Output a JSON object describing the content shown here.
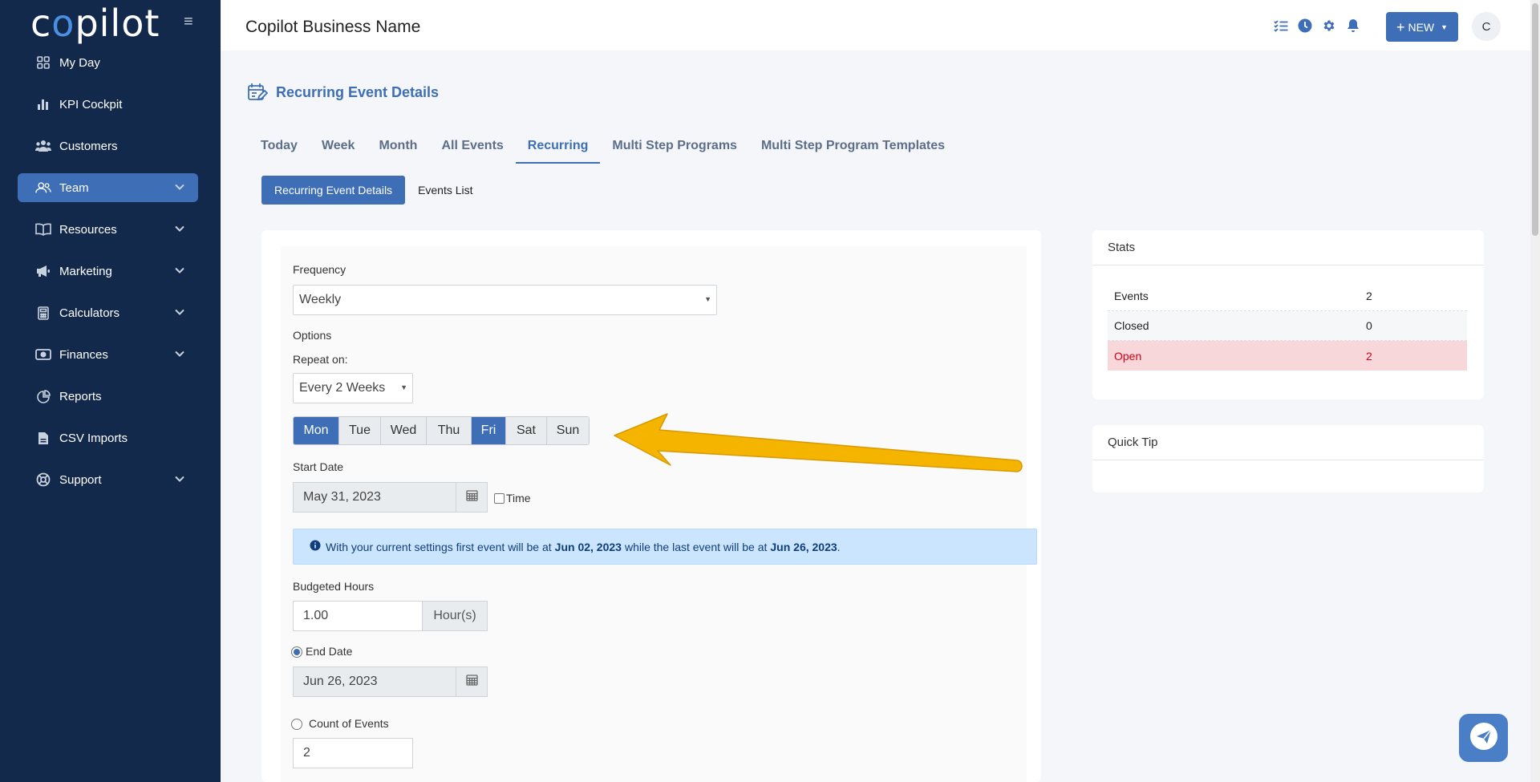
{
  "sidebar": {
    "logo": "copilot",
    "items": [
      {
        "label": "My Day",
        "icon": "grid-icon"
      },
      {
        "label": "KPI Cockpit",
        "icon": "bar-chart-icon"
      },
      {
        "label": "Customers",
        "icon": "users-icon"
      },
      {
        "label": "Team",
        "icon": "team-icon",
        "active": true,
        "expandable": true
      },
      {
        "label": "Resources",
        "icon": "book-icon",
        "expandable": true
      },
      {
        "label": "Marketing",
        "icon": "megaphone-icon",
        "expandable": true
      },
      {
        "label": "Calculators",
        "icon": "calculator-icon",
        "expandable": true
      },
      {
        "label": "Finances",
        "icon": "money-icon",
        "expandable": true
      },
      {
        "label": "Reports",
        "icon": "pie-chart-icon"
      },
      {
        "label": "CSV Imports",
        "icon": "file-csv-icon"
      },
      {
        "label": "Support",
        "icon": "lifebuoy-icon",
        "expandable": true
      }
    ]
  },
  "header": {
    "business_name": "Copilot Business Name",
    "new_button": "NEW",
    "avatar_initial": "C",
    "icons": [
      "tasks-icon",
      "clock-icon",
      "gear-icon",
      "bell-icon"
    ]
  },
  "page": {
    "title": "Recurring Event Details",
    "tabs": [
      "Today",
      "Week",
      "Month",
      "All Events",
      "Recurring",
      "Multi Step Programs",
      "Multi Step Program Templates"
    ],
    "active_tab": "Recurring",
    "subtabs": [
      "Recurring Event Details",
      "Events List"
    ],
    "active_subtab": "Recurring Event Details"
  },
  "form": {
    "frequency_label": "Frequency",
    "frequency_value": "Weekly",
    "options_label": "Options",
    "repeat_on_label": "Repeat on:",
    "repeat_value": "Every 2 Weeks",
    "days": [
      {
        "label": "Mon",
        "selected": true
      },
      {
        "label": "Tue",
        "selected": false
      },
      {
        "label": "Wed",
        "selected": false
      },
      {
        "label": "Thu",
        "selected": false
      },
      {
        "label": "Fri",
        "selected": true
      },
      {
        "label": "Sat",
        "selected": false
      },
      {
        "label": "Sun",
        "selected": false
      }
    ],
    "start_date_label": "Start Date",
    "start_date": "May 31, 2023",
    "time_label": "Time",
    "info_prefix": "With your current settings first event will be at",
    "info_first_date": "Jun 02, 2023",
    "info_middle": "while the last event will be at",
    "info_last_date": "Jun 26, 2023",
    "info_suffix": ".",
    "budgeted_hours_label": "Budgeted Hours",
    "budgeted_hours": "1.00",
    "hours_unit": "Hour(s)",
    "end_date_label": "End Date",
    "end_date": "Jun 26, 2023",
    "count_label": "Count of Events",
    "count_value": "2"
  },
  "stats": {
    "title": "Stats",
    "rows": [
      {
        "label": "Events",
        "value": "2"
      },
      {
        "label": "Closed",
        "value": "0"
      },
      {
        "label": "Open",
        "value": "2"
      }
    ]
  },
  "quick_tip": {
    "title": "Quick Tip"
  },
  "colors": {
    "sidebar": "#13294b",
    "accent": "#3d6eb6",
    "arrow": "#f5b400",
    "open_row": "#f8d7da"
  }
}
